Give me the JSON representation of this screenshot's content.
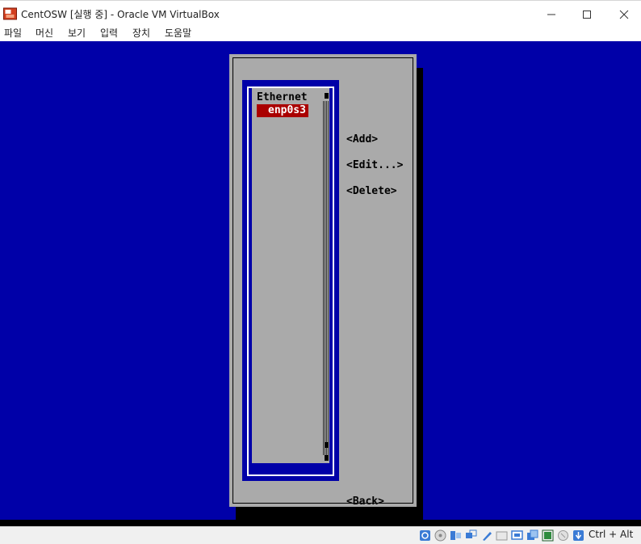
{
  "window": {
    "title": "CentOSW [실행 중] - Oracle VM VirtualBox"
  },
  "menu": {
    "items": [
      "파일",
      "머신",
      "보기",
      "입력",
      "장치",
      "도움말"
    ]
  },
  "tui": {
    "list_header": "Ethernet",
    "connections": [
      "enp0s3"
    ],
    "buttons": {
      "add": "<Add>",
      "edit": "<Edit...>",
      "delete": "<Delete>",
      "back": "<Back>"
    }
  },
  "statusbar": {
    "host_key": "Ctrl + Alt",
    "icons": [
      "hard-disk-icon",
      "optical-drive-icon",
      "audio-icon",
      "network-icon",
      "usb-icon",
      "shared-folders-icon",
      "display-icon",
      "video-capture-icon",
      "recording-icon",
      "cpu-icon",
      "mouse-integration-icon",
      "keyboard-icon"
    ]
  },
  "colors": {
    "vm_background": "#0000a8",
    "dialog_gray": "#aaaaaa",
    "selection_red": "#aa0000"
  }
}
